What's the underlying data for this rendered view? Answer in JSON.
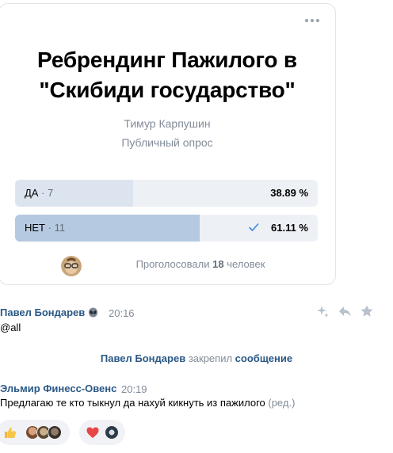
{
  "poll": {
    "title_line1": "Ребрендинг Пажилого в",
    "title_line2": "\"Скибиди государство\"",
    "author": "Тимур Карпушин",
    "type": "Публичный опрос",
    "answers": [
      {
        "label": "ДА",
        "count": "· 7",
        "percent": "38.89 %",
        "share": 38.89,
        "voted": false
      },
      {
        "label": "НЕТ",
        "count": "· 11",
        "percent": "61.11 %",
        "share": 61.11,
        "voted": true
      }
    ],
    "voters_prefix": "Проголосовали",
    "voters_count": "18",
    "voters_suffix": "человек"
  },
  "messages": [
    {
      "author": "Павел Бондарев",
      "time": "20:16",
      "text": "@all"
    },
    {
      "author": "Эльмир Финесс-Овенс",
      "time": "20:19",
      "text": "Предлагаю те кто тыкнул да нахуй кикнуть из пажилого",
      "edited": "(ред.)"
    }
  ],
  "service": {
    "actor": "Павел Бондарев",
    "action": "закрепил",
    "object": "сообщение"
  },
  "colors": {
    "link": "#2a5885",
    "muted": "#818c99",
    "poll_bar": "#dce5ef",
    "poll_bar_voted": "#b5c9e0",
    "accent": "#3f8ae0"
  },
  "icons": {
    "menu": "more-horizontal-icon",
    "check": "checkmark-icon",
    "author_badge": "alien-icon",
    "actions": [
      "sparkle-icon",
      "reply-icon",
      "star-icon"
    ],
    "reaction_1": "thumbs-up-emoji",
    "reaction_2": "heart-emoji"
  }
}
